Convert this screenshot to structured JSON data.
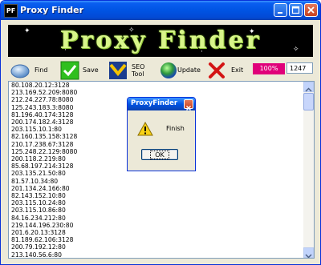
{
  "window": {
    "title": "Proxy Finder",
    "icon_text": "PF"
  },
  "banner": {
    "text": "Proxy Finder"
  },
  "toolbar": {
    "find_label": "Find",
    "save_label": "Save",
    "seo_label_line1": "SEO",
    "seo_label_line2": "Tool",
    "update_label": "Update",
    "exit_label": "Exit",
    "progress_text": "100%",
    "progress_value": 1.0,
    "count_value": "1247"
  },
  "proxies": [
    "80.108.20.12:3128",
    "213.169.52.209:8080",
    "212.24.227.78:8080",
    "125.243.183.3:8080",
    "81.196.40.174:3128",
    "200.174.182.4:3128",
    "203.115.10.1:80",
    "82.160.135.158:3128",
    "210.17.238.67:3128",
    "125.248.22.129:8080",
    "200.118.2.219:80",
    "85.68.197.214:3128",
    "203.135.21.50:80",
    "81.57.10.34:80",
    "201.134.24.166:80",
    "82.143.152.10:80",
    "203.115.10.24:80",
    "203.115.10.86:80",
    "84.16.234.212:80",
    "219.144.196.230:80",
    "201.6.20.13:3128",
    "81.189.62.106:3128",
    "200.79.192.12:80",
    "213.140.56.6:80"
  ],
  "dialog": {
    "title": "ProxyFinder",
    "message": "Finish",
    "ok_label": "OK"
  },
  "colors": {
    "titlebar": "#0054e3",
    "banner_text": "#d8f58a",
    "progress": "#e0007a"
  }
}
